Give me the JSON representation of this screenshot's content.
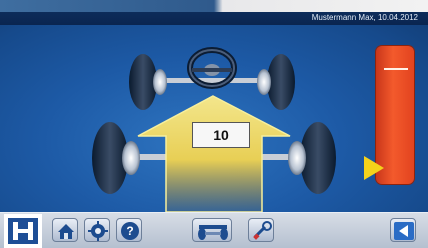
{
  "titlebar": {
    "user_date": "Mustermann Max, 10.04.2012"
  },
  "vehicle_view": {
    "measurement_value": "10"
  },
  "gauge": {
    "color": "#e84a24",
    "marker_color": "#f5d21a"
  },
  "icons": {
    "logo": "hofmann-logo",
    "home": "home-icon",
    "settings": "settings-icon",
    "help": "help-icon",
    "vehicle": "vehicle-lift-icon",
    "tool": "wrench-adjust-icon",
    "back": "back-arrow-icon"
  }
}
